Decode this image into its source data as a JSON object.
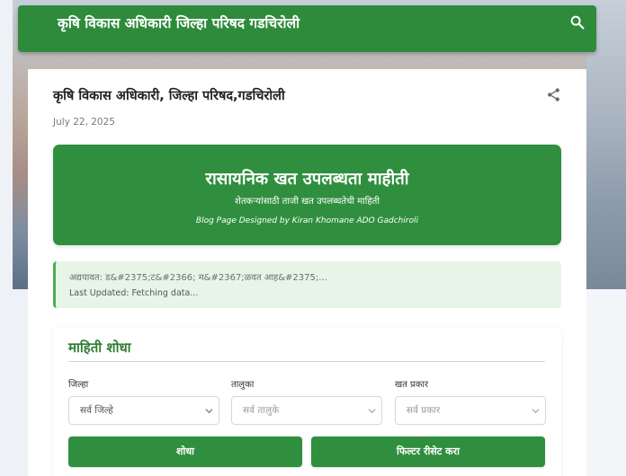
{
  "header": {
    "site_title": "कृषि विकास अधिकारी जिल्हा परिषद गडचिरोली"
  },
  "post": {
    "title": "कृषि विकास अधिकारी, जिल्हा परिषद,गडचिरोली",
    "date": "July 22, 2025"
  },
  "hero": {
    "title": "रासायनिक खत उपलब्धता माहीती",
    "subtitle": "शेतकऱ्यांसाठी ताजी खत उपलब्धतेची माहिती",
    "credit": "Blog Page Designed by Kiran Khomane ADO Gadchiroli"
  },
  "notice": {
    "line1": "अद्ययावत: ड&#2375;ट&#2366; म&#2367;ळवत आह&#2375;...",
    "line2": "Last Updated: Fetching data..."
  },
  "search_panel": {
    "title": "माहिती शोधा",
    "district_label": "जिल्हा",
    "taluka_label": "तालुका",
    "fertilizer_label": "खत प्रकार",
    "district_value": "सर्व जिल्हे",
    "taluka_value": "सर्व तालुके",
    "fertilizer_value": "सर्व प्रकार",
    "search_button": "शोधा",
    "reset_button": "फिल्टर रीसेट करा"
  },
  "icons": {
    "search": "search-icon",
    "share": "share-icon",
    "dropdown": "chevron-down-icon"
  },
  "colors": {
    "primary_green": "#2e8b3b",
    "notice_bg": "#e6f5e7",
    "heading_green": "#2e7d32"
  }
}
